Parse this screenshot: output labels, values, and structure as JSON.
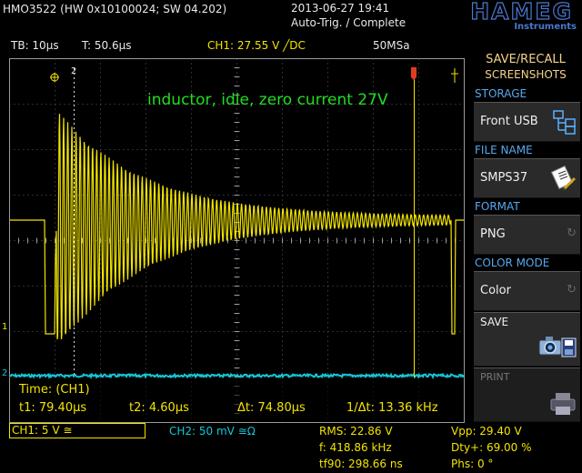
{
  "header": {
    "model": "HMO3522 (HW 0x10100024; SW 04.202)",
    "datetime": "2013-06-27 19:41",
    "trigger_status": "Auto-Trig. / Complete",
    "brand": "HAMEG",
    "brand_sub": "Instruments"
  },
  "top_bar": {
    "timebase": "TB: 10µs",
    "trigger_time": "T: 50.6µs",
    "ch1_trigger": "CH1: 27.55 V ╱DC",
    "sample_rate": "50MSa"
  },
  "annotation": "inductor, idle, zero current 27V",
  "markers": {
    "cursor2": "2",
    "ch1": "1",
    "ch2": "2"
  },
  "cursor_panel": {
    "title": "Time: (CH1)",
    "t1": "t1: 79.40µs",
    "t2": "t2: 4.60µs",
    "dt": "Δt: 74.80µs",
    "inv_dt": "1/Δt: 13.36 kHz"
  },
  "channels": {
    "ch1": "CH1: 5 V ≅",
    "ch2": "CH2: 50 mV ≅Ω"
  },
  "measurements": {
    "rms": "RMS: 22.86 V",
    "freq": "f: 418.86 kHz",
    "tf90": "tf90: 298.66 ns",
    "vpp": "Vpp: 29.40 V",
    "duty": "Dty+: 69.00 %",
    "phase": "Phs: 0 °"
  },
  "sidebar": {
    "title_line1": "SAVE/RECALL",
    "title_line2": "SCREENSHOTS",
    "storage_label": "STORAGE",
    "storage_value": "Front USB",
    "filename_label": "FILE NAME",
    "filename_value": "SMPS37",
    "format_label": "FORMAT",
    "format_value": "PNG",
    "colormode_label": "COLOR MODE",
    "colormode_value": "Color",
    "save_label": "SAVE",
    "print_label": "PRINT"
  },
  "colors": {
    "ch1": "#f2e400",
    "ch2": "#13c8d8",
    "annotation": "#22dd22",
    "brand": "#4a78d0",
    "sidebar_heading": "#f2d38a",
    "menu_label": "#56a9f0"
  },
  "icons": [
    "usb-storage-icon",
    "file-edit-icon",
    "cycle-icon",
    "camera-save-icon",
    "printer-icon",
    "trigger-marker-icon"
  ]
}
